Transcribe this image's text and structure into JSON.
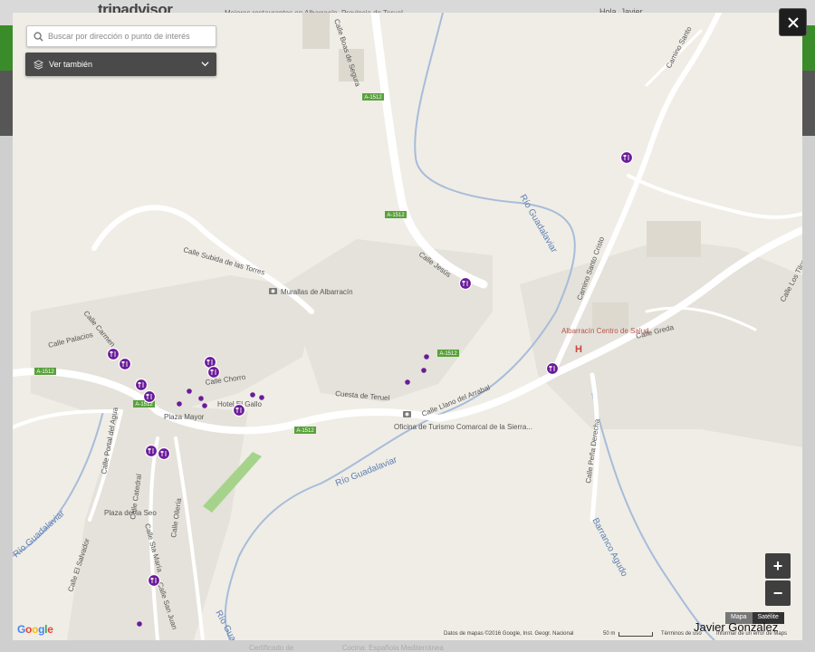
{
  "page_header": {
    "logo": "tripadvisor",
    "breadcrumb": "Mejores restaurantes en Albarracín, Provincia de Teruel",
    "user": "Hola, Javier"
  },
  "page_footer": {
    "certificate": "Certificado de",
    "cocina_label": "Cocina:",
    "cocina_tags": [
      "Española",
      "Mediterránea"
    ]
  },
  "search": {
    "placeholder": "Buscar por dirección o punto de interés"
  },
  "see_also": {
    "label": "Ver también"
  },
  "map_labels": {
    "streets": [
      "Calle Boas de Segura",
      "Camino Santo",
      "Calle Subida de las Torres",
      "Calle Jesús",
      "Camino Santo Cristo",
      "Calle Palacios",
      "Calle Carmen",
      "Calle Chorro",
      "Hotel El Gallo",
      "Plaza Mayor",
      "Cuesta de Teruel",
      "Calle Llano del Arrabal",
      "Calle Portal del Agua",
      "Calle Catedral",
      "Calle Sta María",
      "Calle San Juan",
      "Calle Ollería",
      "Plaza del la Seo",
      "Calle El Salvador",
      "Calle Peña Derecha",
      "Calle Greda",
      "Calle Los Tilos"
    ],
    "rivers": [
      "Río Guadalaviar",
      "Río Guadalaviar",
      "Río Guadalaviar",
      "Río Guadalaviar",
      "Barranco Agudo"
    ],
    "roads": [
      "A-1512",
      "A-1512",
      "A-1512",
      "A-1512",
      "A-1512",
      "A-1512"
    ],
    "pois": [
      "Murallas de Albarracín",
      "Albarracín Centro de Salud",
      "Oficina de Turismo Comarcal de la Sierra..."
    ],
    "hospital_symbol": "H"
  },
  "controls": {
    "zoom_in": "+",
    "zoom_out": "−",
    "map_type": [
      "Mapa",
      "Satélite"
    ],
    "close": "✕"
  },
  "footer": {
    "logo": "Google",
    "attribution": "Datos de mapas ©2016 Google, Inst. Geogr. Nacional",
    "scale": "50 m",
    "terms": "Términos de uso",
    "report": "Informar de un error de Maps",
    "credit": "Javier Gonzalez"
  },
  "colors": {
    "map_bg": "#efede6",
    "block": "#e4e2da",
    "road": "#ffffff",
    "highway": "#fbfbf2",
    "river": "#a8bcd9",
    "marker": "#6a1b9a",
    "green_strip": "#a6d38b",
    "road_shield": "#58a13b"
  },
  "icons": [
    "search-icon",
    "layers-icon",
    "chevron-down-icon",
    "restaurant-marker-icon",
    "camera-icon",
    "close-icon"
  ]
}
